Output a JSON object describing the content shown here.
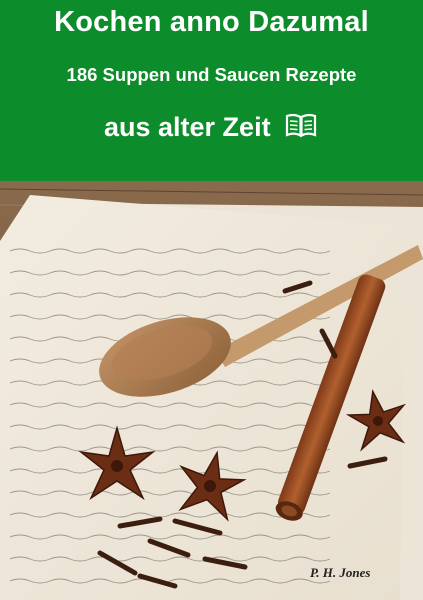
{
  "cover": {
    "title": "Kochen anno Dazumal",
    "subtitle": "186 Suppen und Saucen Rezepte",
    "subtitle_line2": "aus alter Zeit",
    "title_icon": "open-book-icon",
    "author": "P. H. Jones",
    "colors": {
      "banner": "#0c8c2a",
      "banner_text": "#ffffff"
    }
  }
}
